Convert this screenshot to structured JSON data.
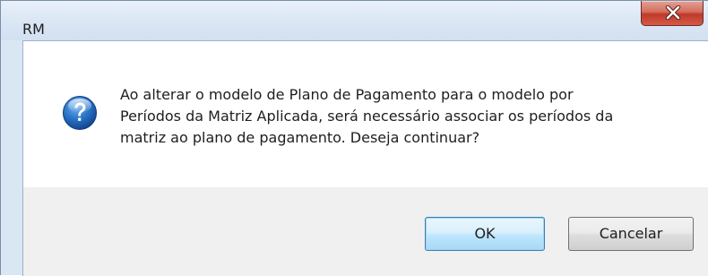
{
  "window": {
    "title": "RM",
    "close_icon": "close-icon"
  },
  "message": {
    "icon": "question-icon",
    "text": "Ao alterar o modelo de Plano de Pagamento para o modelo por\nPeríodos da Matriz Aplicada, será necessário associar os períodos da\nmatriz ao plano de pagamento. Deseja continuar?"
  },
  "buttons": {
    "ok_label": "OK",
    "cancel_label": "Cancelar"
  },
  "colors": {
    "close_button": "#c0392b",
    "icon_blue": "#1e64b4",
    "default_button_border": "#3c7fb1"
  }
}
